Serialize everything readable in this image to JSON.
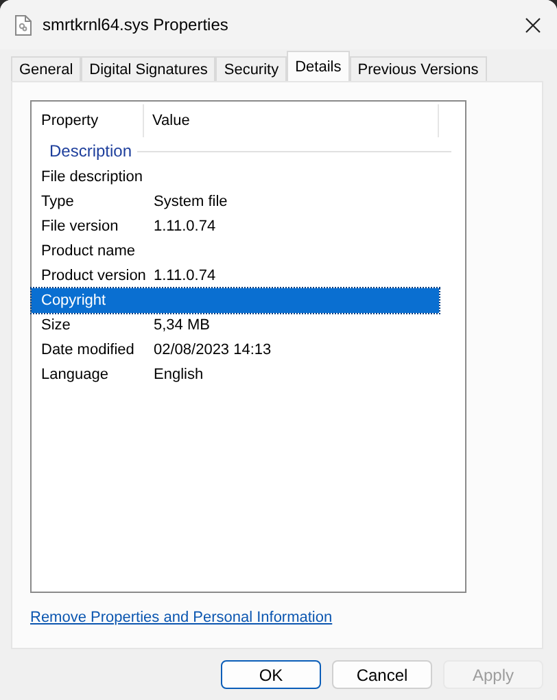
{
  "window": {
    "title": "smrtkrnl64.sys Properties"
  },
  "tabs": [
    {
      "label": "General",
      "selected": false
    },
    {
      "label": "Digital Signatures",
      "selected": false
    },
    {
      "label": "Security",
      "selected": false
    },
    {
      "label": "Details",
      "selected": true
    },
    {
      "label": "Previous Versions",
      "selected": false
    }
  ],
  "details": {
    "columns": [
      "Property",
      "Value"
    ],
    "group": "Description",
    "rows": [
      {
        "property": "File description",
        "selected": false
      },
      {
        "property": "Type",
        "value": "System file",
        "selected": false
      },
      {
        "property": "File version",
        "value": "1.11.0.74",
        "selected": false
      },
      {
        "property": "Product name",
        "selected": false
      },
      {
        "property": "Product version",
        "value": "1.11.0.74",
        "selected": false
      },
      {
        "property": "Copyright",
        "selected": true
      },
      {
        "property": "Size",
        "value": "5,34 MB",
        "selected": false
      },
      {
        "property": "Date modified",
        "value": "02/08/2023 14:13",
        "selected": false
      },
      {
        "property": "Language",
        "value": "English",
        "selected": false
      }
    ]
  },
  "link": "Remove Properties and Personal Information",
  "buttons": [
    {
      "label": "OK",
      "default": true,
      "disabled": false
    },
    {
      "label": "Cancel",
      "default": false,
      "disabled": false
    },
    {
      "label": "Apply",
      "default": false,
      "disabled": true
    }
  ]
}
